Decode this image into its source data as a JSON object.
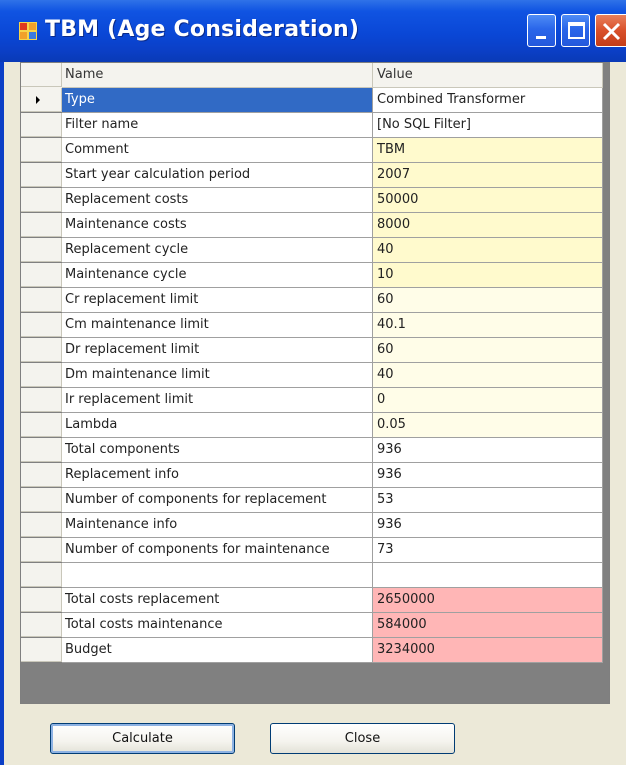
{
  "window": {
    "title": "TBM (Age Consideration)"
  },
  "colors": {
    "white": "#ffffff",
    "yellow": "#fffacd",
    "light_yellow": "#fffde8",
    "pink": "#ffb6b6"
  },
  "grid": {
    "headers": {
      "name": "Name",
      "value": "Value"
    },
    "rows": [
      {
        "name": "Type",
        "value": "Combined Transformer",
        "bg": "white",
        "selected": true
      },
      {
        "name": "Filter name",
        "value": "[No SQL Filter]",
        "bg": "white",
        "selected": false
      },
      {
        "name": "Comment",
        "value": "TBM",
        "bg": "yellow",
        "selected": false
      },
      {
        "name": "Start year calculation period",
        "value": "2007",
        "bg": "yellow",
        "selected": false
      },
      {
        "name": "Replacement costs",
        "value": "50000",
        "bg": "yellow",
        "selected": false
      },
      {
        "name": "Maintenance costs",
        "value": "8000",
        "bg": "yellow",
        "selected": false
      },
      {
        "name": "Replacement cycle",
        "value": "40",
        "bg": "yellow",
        "selected": false
      },
      {
        "name": "Maintenance cycle",
        "value": "10",
        "bg": "yellow",
        "selected": false
      },
      {
        "name": "Cr replacement limit",
        "value": "60",
        "bg": "light_yellow",
        "selected": false
      },
      {
        "name": "Cm maintenance limit",
        "value": "40.1",
        "bg": "light_yellow",
        "selected": false
      },
      {
        "name": "Dr replacement limit",
        "value": "60",
        "bg": "light_yellow",
        "selected": false
      },
      {
        "name": "Dm maintenance limit",
        "value": "40",
        "bg": "light_yellow",
        "selected": false
      },
      {
        "name": "Ir replacement limit",
        "value": "0",
        "bg": "light_yellow",
        "selected": false
      },
      {
        "name": "Lambda",
        "value": "0.05",
        "bg": "light_yellow",
        "selected": false
      },
      {
        "name": "Total components",
        "value": "936",
        "bg": "white",
        "selected": false
      },
      {
        "name": "Replacement info",
        "value": "936",
        "bg": "white",
        "selected": false
      },
      {
        "name": "Number of components for replacement",
        "value": "53",
        "bg": "white",
        "selected": false
      },
      {
        "name": "Maintenance info",
        "value": "936",
        "bg": "white",
        "selected": false
      },
      {
        "name": "Number of components for maintenance",
        "value": "73",
        "bg": "white",
        "selected": false
      },
      {
        "name": "",
        "value": "",
        "bg": "white",
        "selected": false
      },
      {
        "name": "Total costs replacement",
        "value": "2650000",
        "bg": "pink",
        "selected": false
      },
      {
        "name": "Total costs maintenance",
        "value": "584000",
        "bg": "pink",
        "selected": false
      },
      {
        "name": "Budget",
        "value": "3234000",
        "bg": "pink",
        "selected": false
      }
    ]
  },
  "buttons": {
    "calculate": "Calculate",
    "close": "Close"
  }
}
